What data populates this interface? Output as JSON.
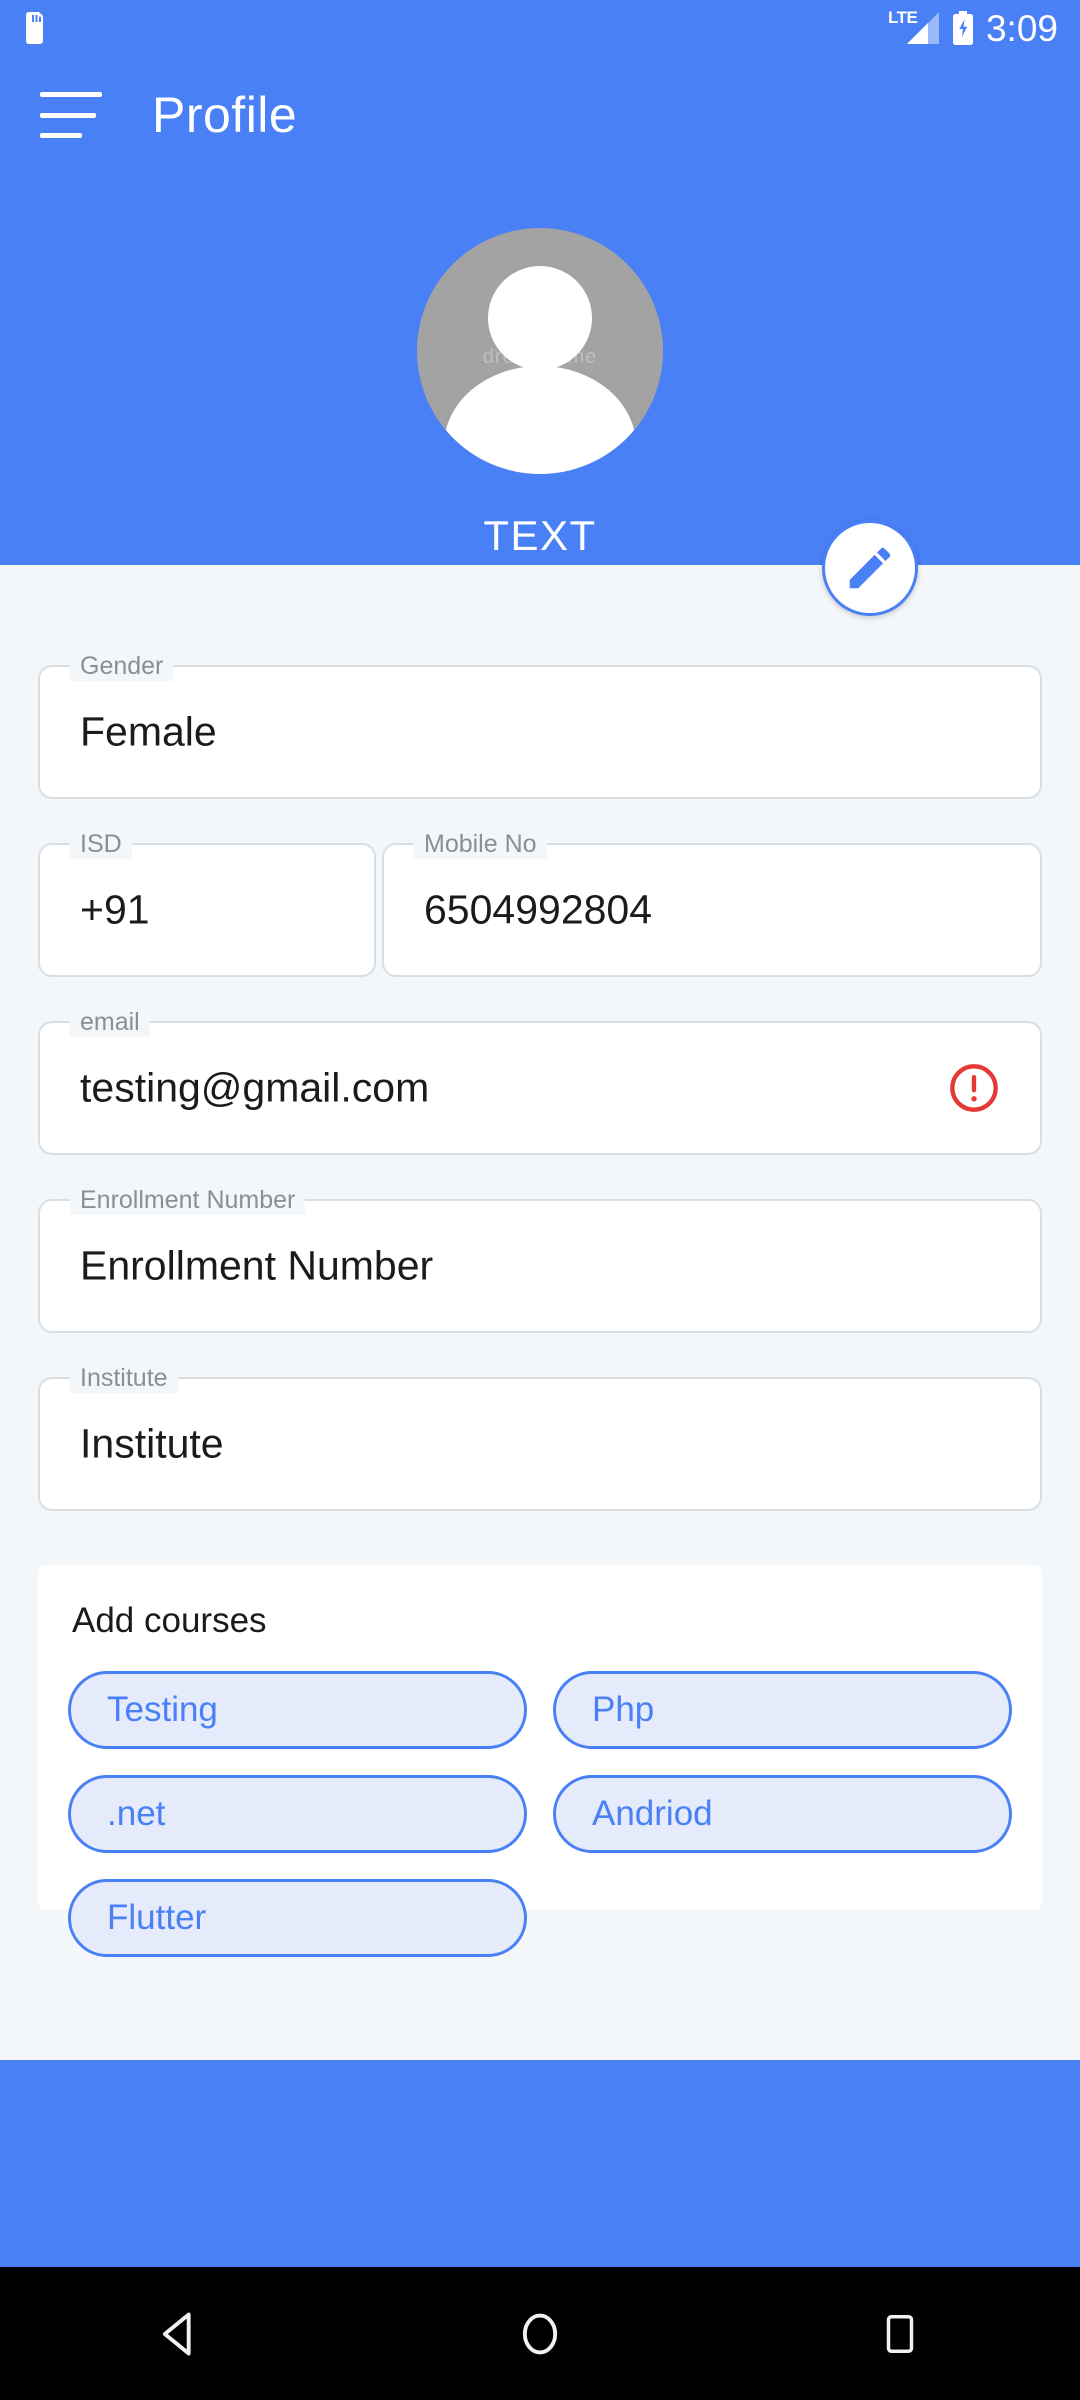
{
  "statusbar": {
    "sdcard_icon": "sdcard-icon",
    "network_label": "LTE",
    "signal_icon": "signal-bars-icon",
    "battery_icon": "battery-charging-icon",
    "time": "3:09"
  },
  "appbar": {
    "menu_icon": "hamburger-menu-icon",
    "title": "Profile"
  },
  "profile": {
    "avatar_icon": "person-avatar-icon",
    "avatar_watermark": "dreamstime",
    "name": "TEXT",
    "edit_icon": "pencil-edit-icon"
  },
  "colors": {
    "primary": "#4a80f5",
    "page_bg": "#f4f7f9",
    "field_border": "#d9dee3",
    "label_text": "#8a8f96",
    "value_text": "#1b1b1b",
    "error": "#e53935",
    "chip_fill": "#e5ebfb",
    "chip_border": "#4a80f5",
    "chip_text": "#4a80f5",
    "avatar_bg": "#a3a3a3",
    "navbar_bg": "#000000"
  },
  "form": {
    "gender": {
      "label": "Gender",
      "value": "Female",
      "placeholder": "Gender"
    },
    "isd": {
      "label": "ISD",
      "value": "+91",
      "placeholder": "ISD"
    },
    "mobile": {
      "label": "Mobile No",
      "value": "6504992804",
      "placeholder": "Mobile No"
    },
    "email": {
      "label": "email",
      "value": "testing@gmail.com",
      "placeholder": "email",
      "error_icon": "error-circle-icon",
      "has_error": true
    },
    "enrollment": {
      "label": "Enrollment Number",
      "value": "Enrollment Number",
      "placeholder": "Enrollment Number"
    },
    "institute": {
      "label": "Institute",
      "value": "Institute",
      "placeholder": "Institute"
    }
  },
  "courses": {
    "title": "Add courses",
    "chips": [
      {
        "label": "Testing"
      },
      {
        "label": "Php"
      },
      {
        "label": ".net"
      },
      {
        "label": "Andriod"
      },
      {
        "label": "Flutter"
      }
    ]
  },
  "navbar": {
    "back_icon": "back-triangle-icon",
    "home_icon": "home-circle-icon",
    "recents_icon": "recents-square-icon"
  }
}
